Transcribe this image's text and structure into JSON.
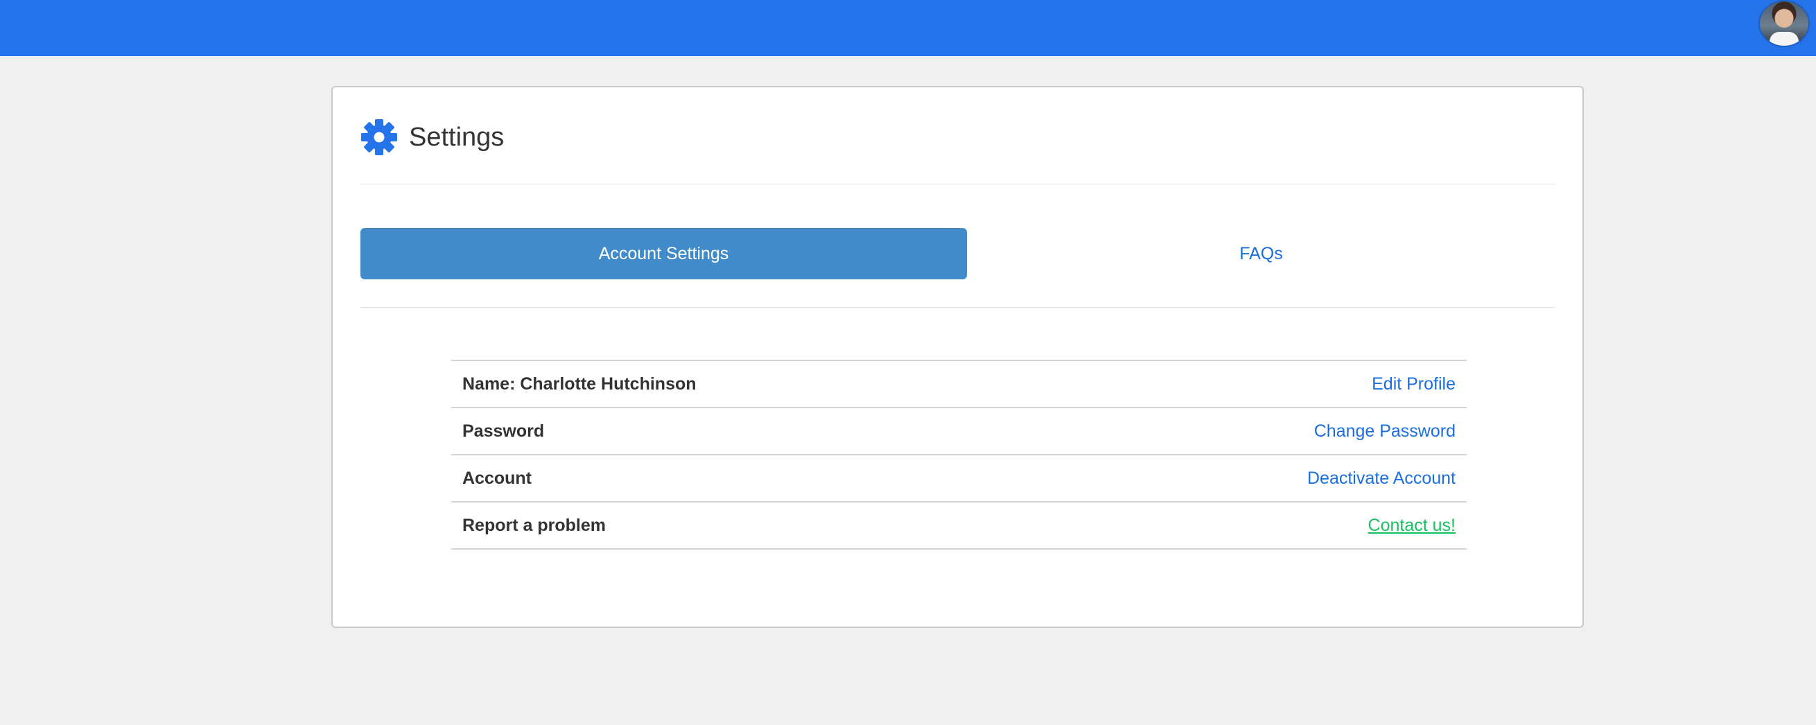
{
  "header": {
    "avatar_icon": "user-avatar-photo",
    "bar_color": "#2473ea"
  },
  "settings": {
    "title": "Settings",
    "icon": "gear-icon",
    "icon_color": "#2473ea"
  },
  "tabs": [
    {
      "label": "Account Settings",
      "active": true
    },
    {
      "label": "FAQs",
      "active": false
    }
  ],
  "rows": [
    {
      "label": "Name: Charlotte Hutchinson",
      "action": "Edit Profile"
    },
    {
      "label": "Password",
      "action": "Change Password"
    },
    {
      "label": "Account",
      "action": "Deactivate Account"
    },
    {
      "label": "Report a problem",
      "action": "Contact us!"
    }
  ],
  "colors": {
    "active_tab": "#428bca",
    "link": "#1a6fe0",
    "contact_link": "#16c25f"
  }
}
